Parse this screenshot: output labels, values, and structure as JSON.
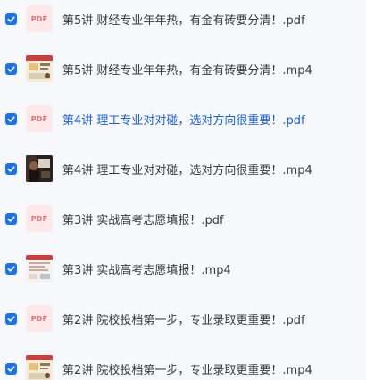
{
  "files": [
    {
      "name": "第5讲 财经专业年年热，有金有砖要分清！.pdf",
      "type": "pdf",
      "thumb_label": "PDF",
      "checked": true,
      "highlighted": false
    },
    {
      "name": "第5讲 财经专业年年热，有金有砖要分清！.mp4",
      "type": "video",
      "checked": true,
      "highlighted": false
    },
    {
      "name": "第4讲 理工专业对对碰，选对方向很重要！.pdf",
      "type": "pdf",
      "thumb_label": "PDF",
      "checked": true,
      "highlighted": true
    },
    {
      "name": "第4讲 理工专业对对碰，选对方向很重要！.mp4",
      "type": "video",
      "checked": true,
      "highlighted": false
    },
    {
      "name": "第3讲 实战高考志愿填报！.pdf",
      "type": "pdf",
      "thumb_label": "PDF",
      "checked": true,
      "highlighted": false
    },
    {
      "name": "第3讲 实战高考志愿填报！.mp4",
      "type": "video",
      "checked": true,
      "highlighted": false
    },
    {
      "name": "第2讲 院校投档第一步，专业录取更重要！.pdf",
      "type": "pdf",
      "thumb_label": "PDF",
      "checked": true,
      "highlighted": false
    },
    {
      "name": "第2讲 院校投档第一步，专业录取更重要！.mp4",
      "type": "video",
      "checked": true,
      "highlighted": false
    }
  ],
  "colors": {
    "checkbox": "#1a73e8",
    "highlight_text": "#1a5fd0",
    "pdf_badge_bg": "#fde9e9",
    "pdf_badge_text": "#f46b6b"
  }
}
